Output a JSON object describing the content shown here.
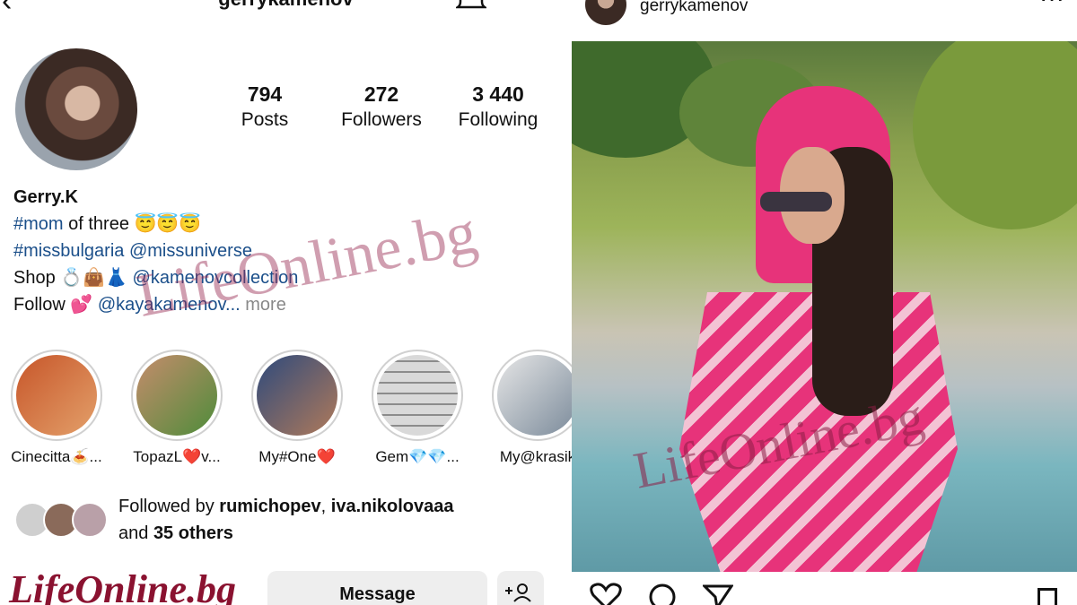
{
  "profile": {
    "username": "gerrykamenov",
    "stats": [
      {
        "value": "794",
        "label": "Posts"
      },
      {
        "value": "272",
        "label": "Followers"
      },
      {
        "value": "3 440",
        "label": "Following"
      }
    ],
    "name": "Gerry.K",
    "bio_line1_tag": "#mom",
    "bio_line1_text": " of three 😇😇😇",
    "bio_line2_tag": "#missbulgaria",
    "bio_line2_mention": "@missuniverse",
    "bio_line3_text": "Shop 💍👜👗 ",
    "bio_line3_mention": "@kamenovcollection",
    "bio_line4_text": "Follow 💕 ",
    "bio_line4_mention": "@kayakamenov...",
    "bio_more": "more",
    "highlights": [
      {
        "label": "Cinecitta🍝...",
        "colors": [
          "#c7562a",
          "#e3a06a"
        ]
      },
      {
        "label": "TopazL❤️v...",
        "colors": [
          "#c58c6c",
          "#4e8c3a"
        ]
      },
      {
        "label": "My#One❤️",
        "colors": [
          "#2e4a7c",
          "#b07a5a"
        ]
      },
      {
        "label": "Gem💎💎...",
        "colors": [
          "#d9d9d9",
          "#8c8c8c"
        ]
      },
      {
        "label": "My@krasik",
        "colors": [
          "#e6e6e6",
          "#7a8a9a"
        ]
      }
    ],
    "followed_by_prefix": "Followed by ",
    "followed_by_user1": "rumichopev",
    "followed_by_sep": ", ",
    "followed_by_user2": "iva.nikolovaaa",
    "followed_by_and": "and ",
    "followed_by_others": "35 others",
    "message_button": "Message"
  },
  "post": {
    "username": "gerrykamenov",
    "more": "···"
  },
  "watermark": "LifeOnline.bg",
  "colors": {
    "link": "#1b4f8a",
    "button_bg": "#eeeeee",
    "watermark": "#8a1230"
  }
}
